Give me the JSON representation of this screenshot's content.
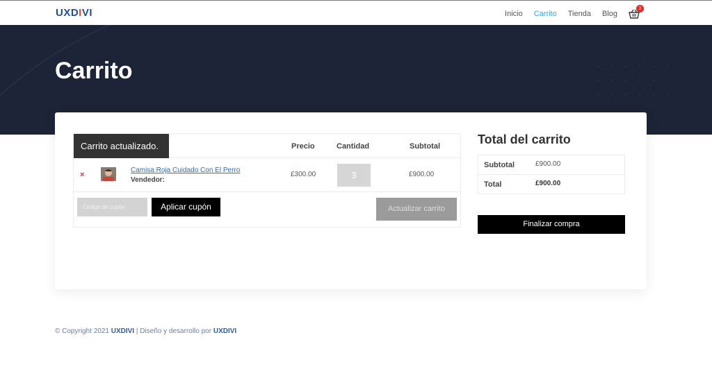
{
  "header": {
    "logo_left": "UXD",
    "logo_o": "I",
    "logo_right": "VI",
    "nav": [
      "Inicio",
      "Carrito",
      "Tienda",
      "Blog"
    ],
    "cart_count": "3"
  },
  "hero": {
    "title": "Carrito"
  },
  "cart": {
    "notice": "Carrito actualizado.",
    "headers": {
      "price": "Precio",
      "quantity": "Cantidad",
      "subtotal": "Subtotal"
    },
    "item": {
      "remove": "×",
      "name": "Camisa Roja Cuidado Con El Perro",
      "vendor": "Vendedor:",
      "price": "£300.00",
      "quantity": "3",
      "subtotal": "£900.00"
    },
    "coupon_placeholder": "Código de cupón",
    "apply_label": "Aplicar cupón",
    "update_label": "Actualizar carrito"
  },
  "totals": {
    "title": "Total del carrito",
    "subtotal_label": "Subtotal",
    "subtotal_value": "£900.00",
    "total_label": "Total",
    "total_value": "£900.00",
    "checkout_label": "Finalizar compra"
  },
  "footer": {
    "prefix": "© Copyright 2021 ",
    "brand1": "UXDIVI",
    "middle": " | Diseño y desarrollo por ",
    "brand2": "UXDIVI"
  },
  "colors": {
    "accent": "#2ea3f2",
    "hero_bg": "#1d2438",
    "badge": "#e02b2b"
  }
}
